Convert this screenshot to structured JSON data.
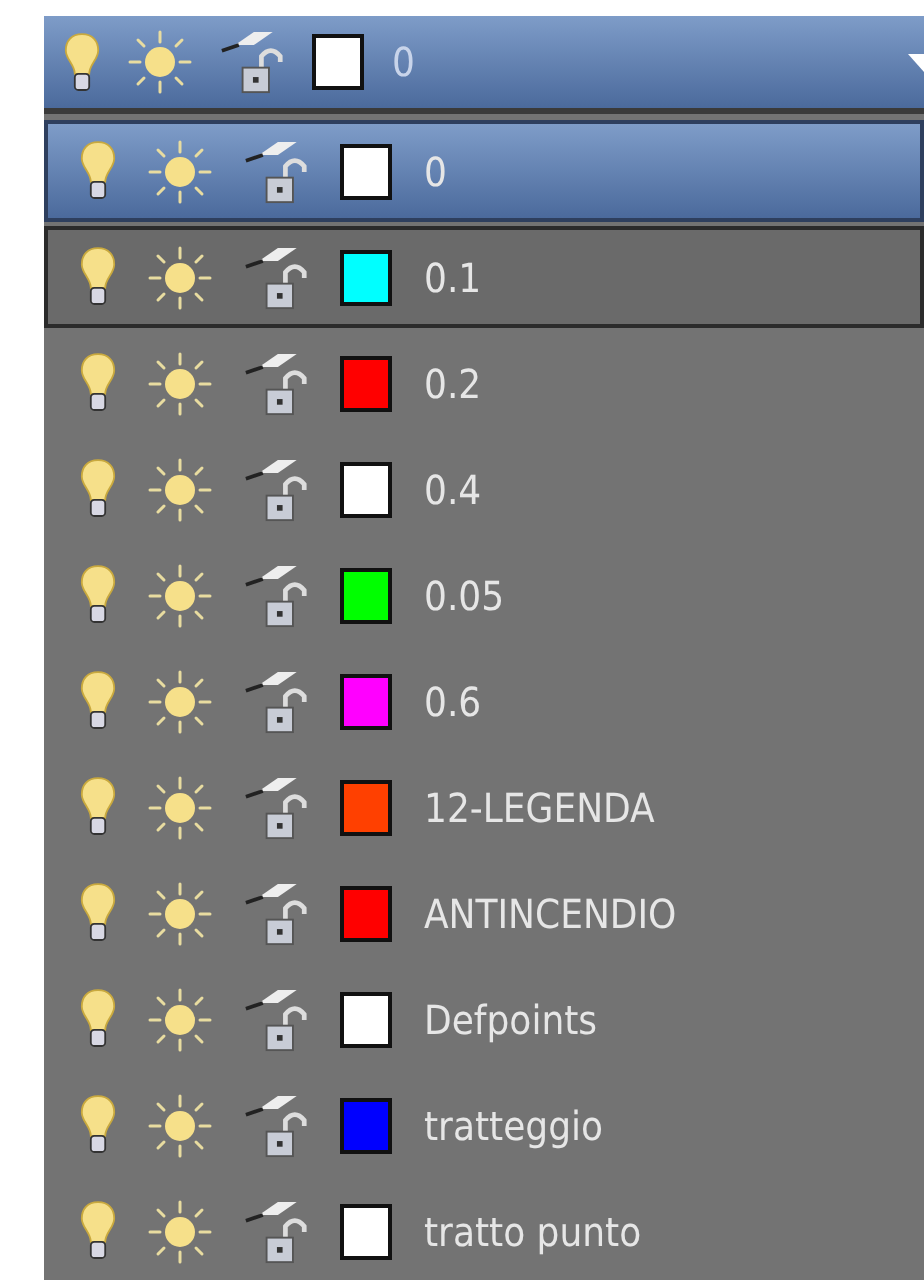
{
  "current_layer": {
    "name": "0",
    "color": "#ffffff",
    "on": true,
    "frozen": false,
    "locked": false
  },
  "layers": [
    {
      "name": "0",
      "color": "#ffffff",
      "on": true,
      "frozen": false,
      "locked": false,
      "selected": true,
      "hovered": false
    },
    {
      "name": "0.1",
      "color": "#00ffff",
      "on": true,
      "frozen": false,
      "locked": false,
      "selected": false,
      "hovered": true
    },
    {
      "name": "0.2",
      "color": "#ff0000",
      "on": true,
      "frozen": false,
      "locked": false,
      "selected": false,
      "hovered": false
    },
    {
      "name": "0.4",
      "color": "#ffffff",
      "on": true,
      "frozen": false,
      "locked": false,
      "selected": false,
      "hovered": false
    },
    {
      "name": "0.05",
      "color": "#00ff00",
      "on": true,
      "frozen": false,
      "locked": false,
      "selected": false,
      "hovered": false
    },
    {
      "name": "0.6",
      "color": "#ff00ff",
      "on": true,
      "frozen": false,
      "locked": false,
      "selected": false,
      "hovered": false
    },
    {
      "name": "12-LEGENDA",
      "color": "#ff4000",
      "on": true,
      "frozen": false,
      "locked": false,
      "selected": false,
      "hovered": false
    },
    {
      "name": "ANTINCENDIO",
      "color": "#ff0000",
      "on": true,
      "frozen": false,
      "locked": false,
      "selected": false,
      "hovered": false
    },
    {
      "name": "Defpoints",
      "color": "#ffffff",
      "on": true,
      "frozen": false,
      "locked": false,
      "selected": false,
      "hovered": false
    },
    {
      "name": "tratteggio",
      "color": "#0000ff",
      "on": true,
      "frozen": false,
      "locked": false,
      "selected": false,
      "hovered": false
    },
    {
      "name": "tratto punto",
      "color": "#ffffff",
      "on": true,
      "frozen": false,
      "locked": false,
      "selected": false,
      "hovered": false
    }
  ]
}
